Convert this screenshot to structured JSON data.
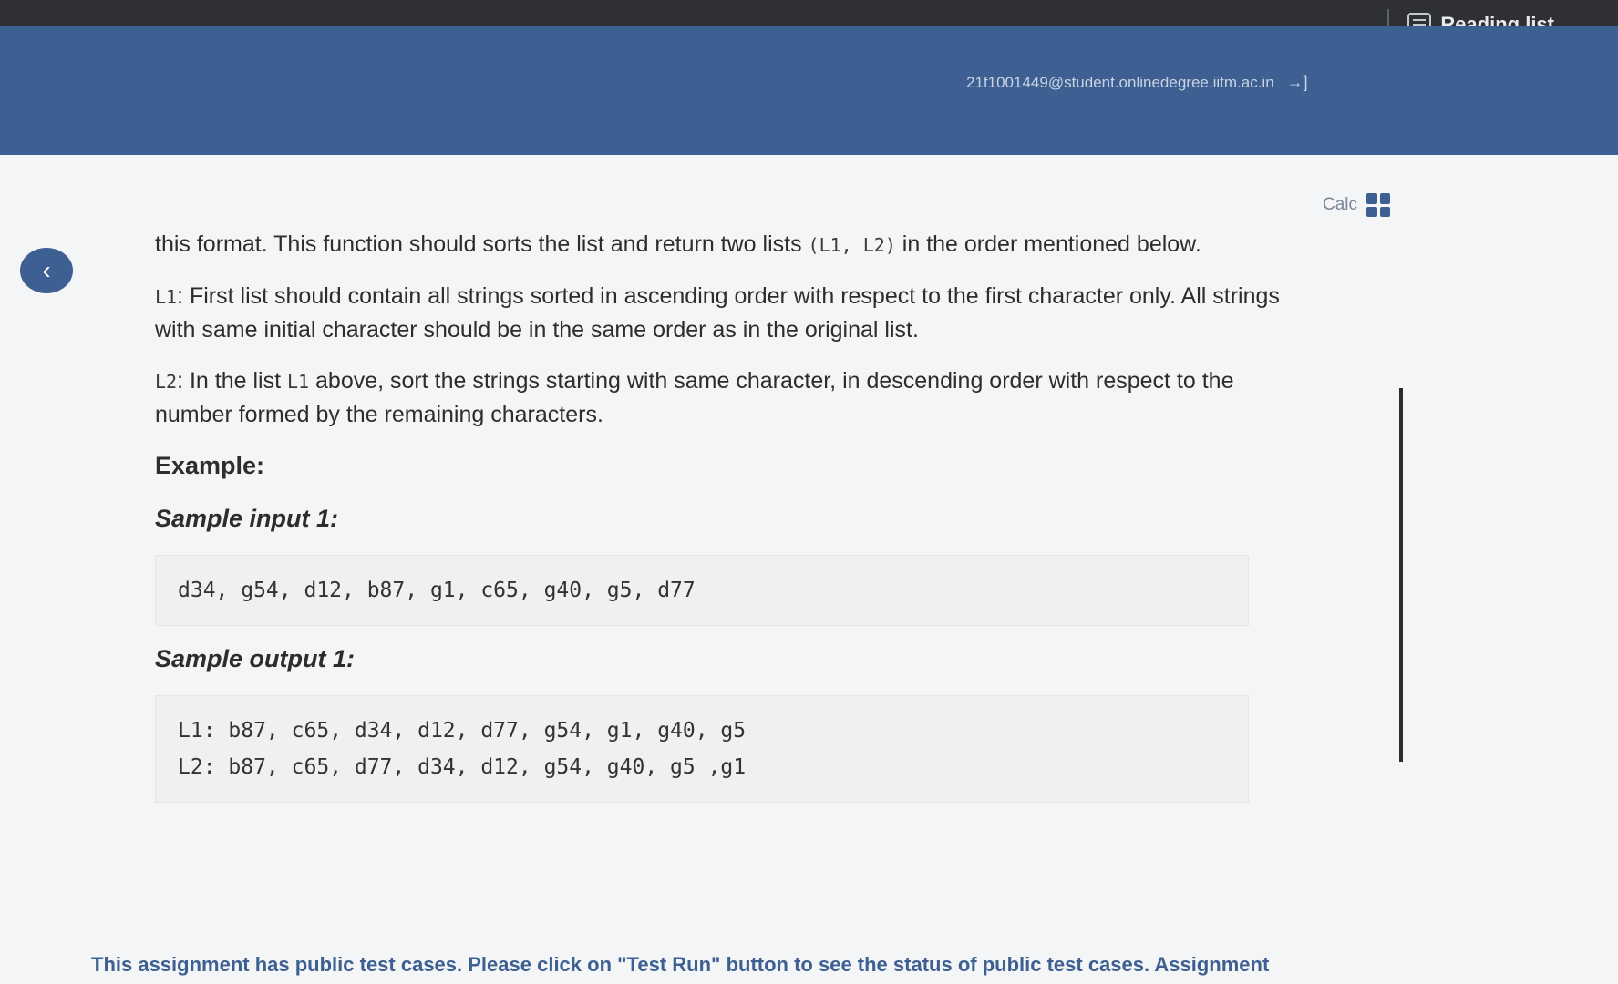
{
  "browser": {
    "reading_list_label": "Reading list"
  },
  "header": {
    "user_email": "21f1001449@student.onlinedegree.iitm.ac.in",
    "logout_icon": "logout-icon"
  },
  "tools": {
    "calc_label": "Calc"
  },
  "question": {
    "intro_part1": "this format. This function should sorts the list  and return two lists ",
    "intro_code": "(L1, L2)",
    "intro_part2": " in the order mentioned below.",
    "l1_code": "L1",
    "l1_text": ": First list should contain all strings sorted in ascending order with respect to the first character only. All strings with same initial character should be in the same order as in the original list.",
    "l2_code": "L2",
    "l2_text_part1": ": In the list ",
    "l2_text_code": "L1",
    "l2_text_part2": " above, sort the strings starting with same character, in descending order with respect to the number formed by the remaining characters.",
    "example_heading": "Example:",
    "sample_input_heading": "Sample input 1:",
    "sample_input": "d34, g54, d12, b87, g1, c65, g40, g5, d77",
    "sample_output_heading": "Sample output 1:",
    "sample_output_l1": "L1: b87, c65, d34, d12, d77, g54, g1, g40, g5",
    "sample_output_l2": "L2: b87, c65, d77, d34, d12, g54, g40, g5 ,g1"
  },
  "footer": {
    "note": "This assignment has public test cases. Please click on \"Test Run\" button to see the status of public test cases. Assignment"
  }
}
